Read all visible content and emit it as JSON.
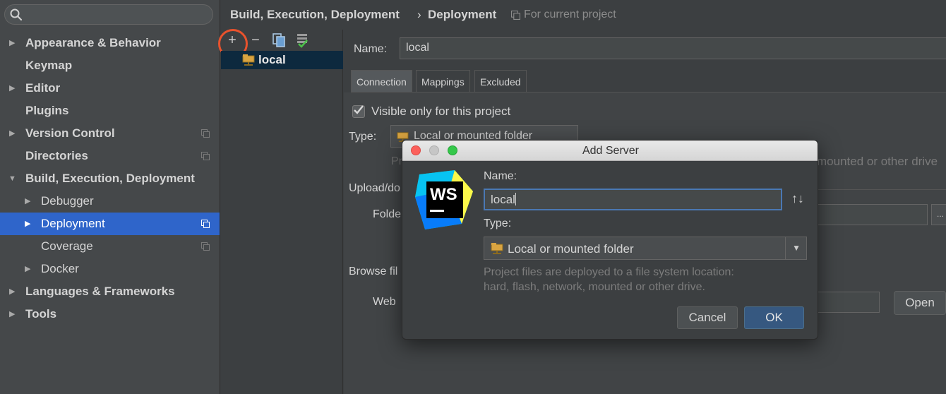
{
  "sidebar": {
    "items": [
      {
        "label": "Appearance & Behavior"
      },
      {
        "label": "Keymap"
      },
      {
        "label": "Editor"
      },
      {
        "label": "Plugins"
      },
      {
        "label": "Version Control"
      },
      {
        "label": "Directories"
      },
      {
        "label": "Build, Execution, Deployment"
      },
      {
        "label": "Debugger"
      },
      {
        "label": "Deployment"
      },
      {
        "label": "Coverage"
      },
      {
        "label": "Docker"
      },
      {
        "label": "Languages & Frameworks"
      },
      {
        "label": "Tools"
      }
    ],
    "arrow_collapsed": "▶",
    "arrow_expanded": "▼"
  },
  "header": {
    "breadcrumb_parent": "Build, Execution, Deployment",
    "separator": "›",
    "breadcrumb_current": "Deployment",
    "scope_note": "For current project"
  },
  "server_list": {
    "toolbar": {
      "add": "+",
      "remove": "−"
    },
    "servers": [
      {
        "name": "local"
      }
    ]
  },
  "settings": {
    "name_label": "Name:",
    "name_value": "local",
    "tabs": [
      "Connection",
      "Mappings",
      "Excluded Paths"
    ],
    "visible_only_label": "Visible only for this project",
    "type_label": "Type:",
    "type_value": "Local or mounted folder",
    "description_partial": "Pr",
    "description_tail": "mounted or other drive",
    "upload_label": "Upload/do",
    "folder_label": "Folde",
    "folder_browse": "...",
    "browse_label": "Browse fil",
    "web_label": "Web",
    "open_button": "Open"
  },
  "dialog": {
    "title": "Add Server",
    "logo_text": "WS",
    "name_label": "Name:",
    "name_value": "local",
    "sort_icon": "↑↓",
    "type_label": "Type:",
    "type_value": "Local or mounted folder",
    "description_line1": "Project files are deployed to a file system location:",
    "description_line2": "hard, flash, network, mounted or other drive.",
    "cancel_label": "Cancel",
    "ok_label": "OK"
  },
  "colors": {
    "selection": "#2f65ca",
    "highlight_ring": "#e8522d",
    "ok_button": "#365880"
  }
}
